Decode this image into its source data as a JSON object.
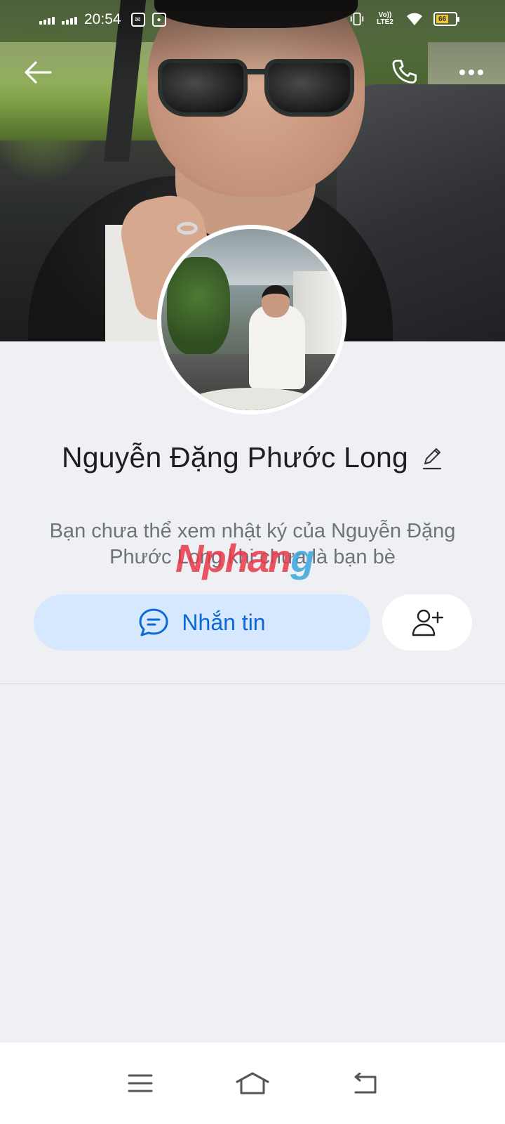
{
  "status_bar": {
    "time": "20:54",
    "network_label": "Vo)) LTE2",
    "battery_percent": "66",
    "battery_level": 0.66,
    "battery_color": "#f4c430"
  },
  "top_bar": {
    "back_icon": "arrow-left-icon",
    "call_icon": "phone-icon",
    "more_icon": "more-horizontal-icon"
  },
  "profile": {
    "name": "Nguyễn Đặng Phước Long",
    "edit_icon": "pencil-icon",
    "notice": "Bạn chưa thể xem nhật ký của Nguyễn Đặng Phước Long khi chưa là bạn bè"
  },
  "watermark": {
    "part1": "Nphan",
    "part2": "g"
  },
  "actions": {
    "message_label": "Nhắn tin",
    "message_icon": "chat-bubble-icon",
    "add_friend_icon": "user-plus-icon"
  },
  "colors": {
    "accent": "#0b68d6",
    "message_button_bg": "#d6e8fd",
    "page_bg": "#eff0f4"
  },
  "nav_bar": {
    "menu_icon": "menu-icon",
    "home_icon": "home-icon",
    "back_icon": "back-return-icon"
  }
}
